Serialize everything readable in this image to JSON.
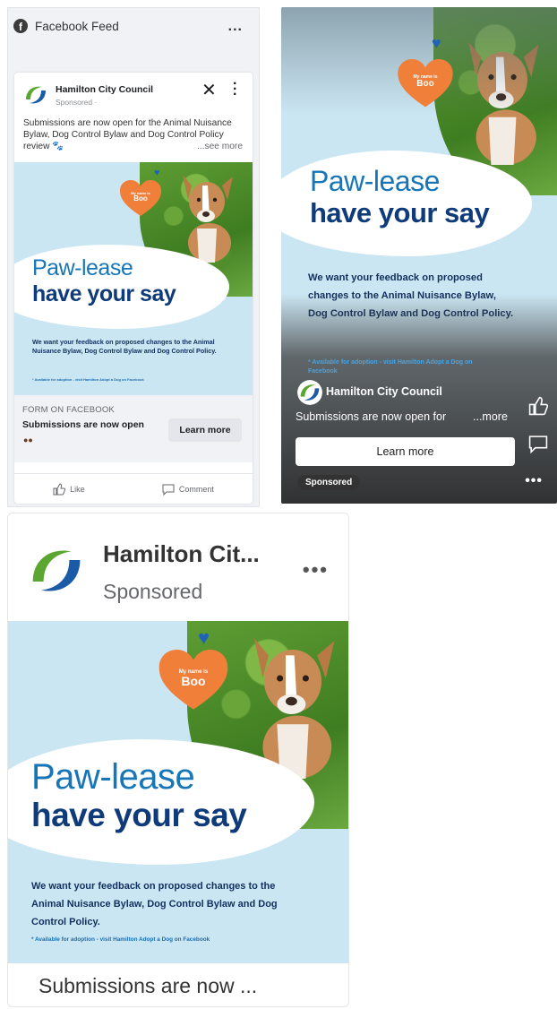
{
  "feed": {
    "header_title": "Facebook Feed",
    "page_name": "Hamilton City Council",
    "sponsored": "Sponsored · ",
    "post_text": "Submissions are now open for the Animal Nuisance Bylaw, Dog Control Bylaw and Dog Control Policy review 🐾",
    "see_more": "...see more",
    "form_label": "FORM ON FACEBOOK",
    "form_title": "Submissions are now open",
    "learn_more": "Learn more",
    "like": "Like",
    "comment": "Comment"
  },
  "creative": {
    "heart_line1": "My name is",
    "heart_line2": "Boo",
    "headline1": "Paw-lease",
    "headline2": "have your say",
    "body": "We want your feedback on proposed changes to the Animal Nuisance Bylaw, Dog Control Bylaw and Dog Control Policy.",
    "footnote": "* Available for adoption - visit Hamilton Adopt a Dog on Facebook"
  },
  "story": {
    "page_name": "Hamilton City Council",
    "text": "Submissions are now open for",
    "more": "...more",
    "learn_more": "Learn more",
    "badge": "Sponsored"
  },
  "column": {
    "page_name": "Hamilton Cit...",
    "sponsored": "Sponsored",
    "bottom_text": "Submissions are now ..."
  },
  "colors": {
    "brand_blue": "#1776b8",
    "brand_navy": "#0f3b7a",
    "brand_green": "#5aa631",
    "heart_orange": "#f07f3a",
    "creative_bg": "#cbe6f3"
  }
}
